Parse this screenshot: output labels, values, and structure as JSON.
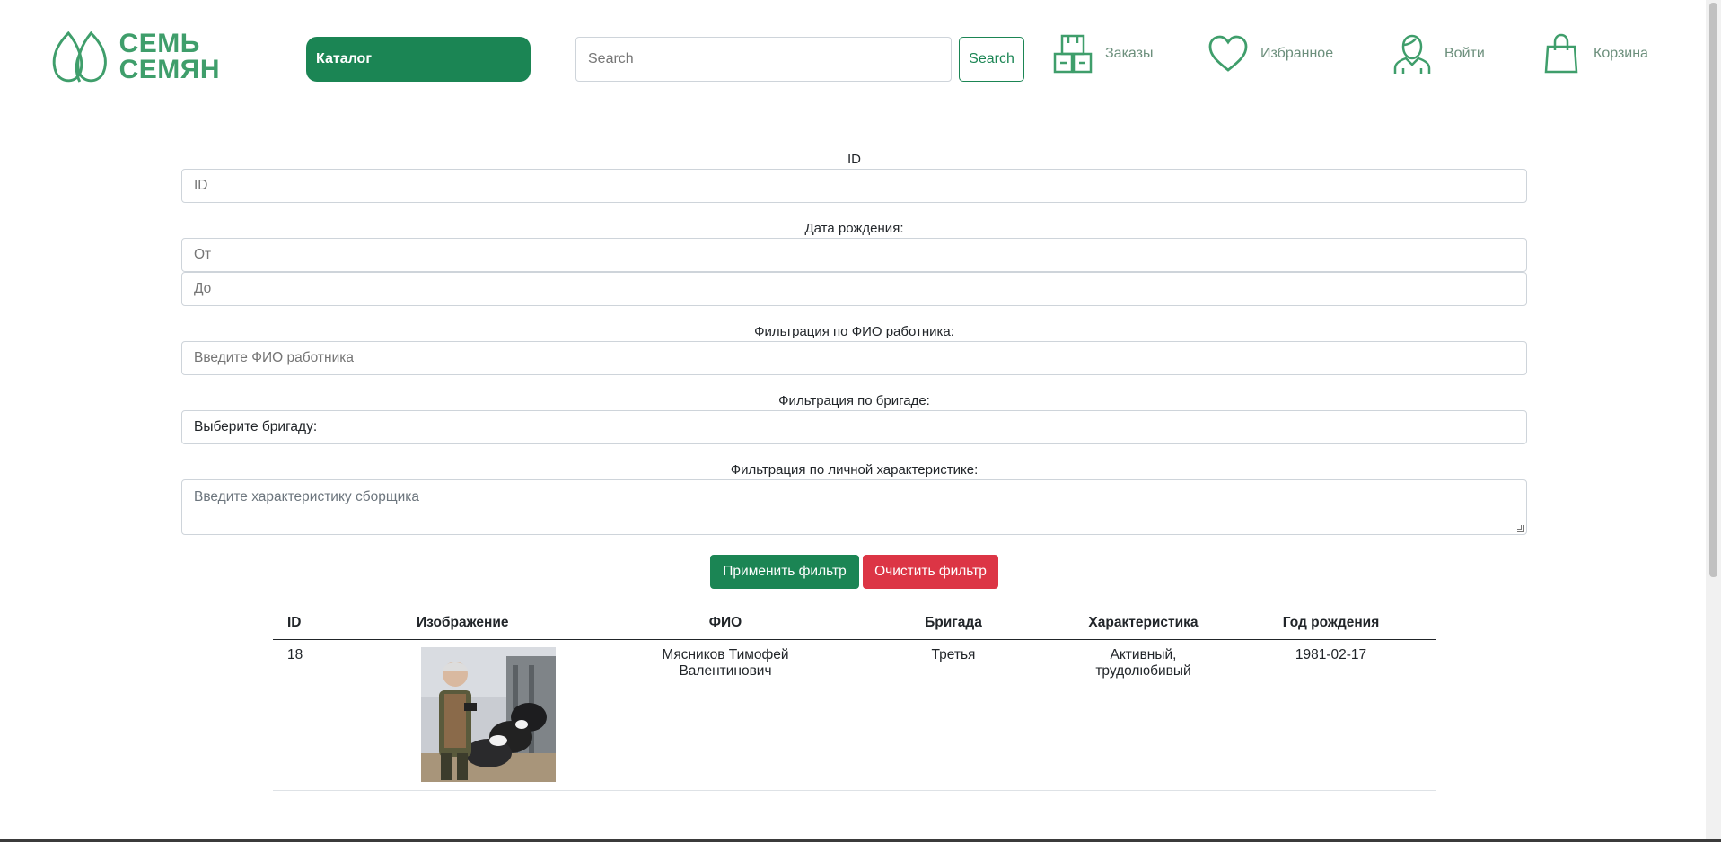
{
  "header": {
    "logo_line1": "СЕМЬ",
    "logo_line2": "СЕМЯН",
    "catalog_label": "Каталог",
    "search_placeholder": "Search",
    "search_button": "Search",
    "nav": {
      "orders": "Заказы",
      "favorites": "Избранное",
      "login": "Войти",
      "cart": "Корзина"
    }
  },
  "form": {
    "id_label": "ID",
    "id_placeholder": "ID",
    "birth_label": "Дата рождения:",
    "birth_from_placeholder": "От",
    "birth_to_placeholder": "До",
    "fio_label": "Фильтрация по ФИО работника:",
    "fio_placeholder": "Введите ФИО работника",
    "brigade_label": "Фильтрация по бригаде:",
    "brigade_value": "Выберите бригаду:",
    "trait_label": "Фильтрация по личной характеристике:",
    "trait_placeholder": "Введите характеристику сборщика",
    "apply_button": "Применить фильтр",
    "clear_button": "Очистить фильтр"
  },
  "table": {
    "headers": [
      "ID",
      "Изображение",
      "ФИО",
      "Бригада",
      "Характеристика",
      "Год рождения"
    ],
    "rows": [
      {
        "id": "18",
        "fio": "Мясников Тимофей Валентинович",
        "brigade": "Третья",
        "trait": "Активный, трудолюбивый",
        "birth": "1981-02-17"
      }
    ]
  },
  "colors": {
    "brand_green": "#1b8554",
    "logo_green": "#3f9e6b",
    "danger_red": "#dc3545"
  }
}
